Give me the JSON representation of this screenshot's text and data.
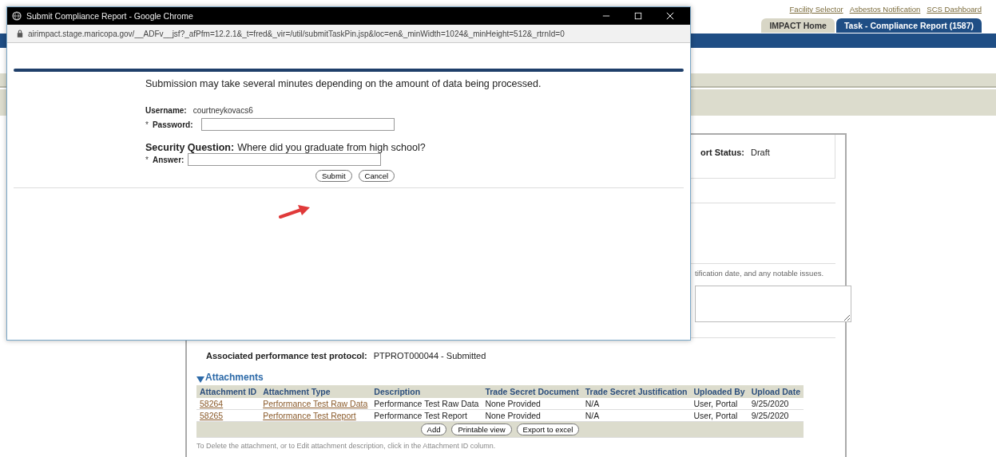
{
  "header_links": [
    "Facility Selector",
    "Asbestos Notification",
    "SCS Dashboard"
  ],
  "tabs": [
    {
      "label": "IMPACT Home",
      "selected": false
    },
    {
      "label": "Task - Compliance Report (1587)",
      "selected": true
    }
  ],
  "report": {
    "status_label": "ort Status:",
    "status_value": "Draft",
    "instructions": "tification date, and any notable issues.",
    "protocol_label": "Associated performance test protocol:",
    "protocol_value": "PTPROT000044 - Submitted"
  },
  "attachments": {
    "title": "Attachments",
    "expanded": true,
    "columns": [
      "Attachment ID",
      "Attachment Type",
      "Description",
      "Trade Secret Document",
      "Trade Secret Justification",
      "Uploaded By",
      "Upload Date"
    ],
    "rows": [
      [
        "58264",
        "Performance Test Raw Data",
        "Performance Test Raw Data",
        "None Provided",
        "N/A",
        "User, Portal",
        "9/25/2020"
      ],
      [
        "58265",
        "Performance Test Report",
        "Performance Test Report",
        "None Provided",
        "N/A",
        "User, Portal",
        "9/25/2020"
      ]
    ],
    "buttons": [
      "Add",
      "Printable view",
      "Export to excel"
    ],
    "note": "To Delete the attachment, or to Edit attachment description, click in the Attachment ID column."
  },
  "popup": {
    "window_title": "Submit Compliance Report - Google Chrome",
    "url": "airimpact.stage.maricopa.gov/__ADFv__jsf?_afPfm=12.2.1&_t=fred&_vir=/util/submitTaskPin.jsp&loc=en&_minWidth=1024&_minHeight=512&_rtrnId=0",
    "message": "Submission may take several minutes depending on the amount of data being processed.",
    "username_label": "Username:",
    "username": "courtneykovacs6",
    "password_label": "Password:",
    "required_mark": "*",
    "question_label": "Security Question:",
    "question": "Where did you graduate from high school?",
    "answer_label": "Answer:",
    "buttons": [
      "Submit",
      "Cancel"
    ]
  }
}
